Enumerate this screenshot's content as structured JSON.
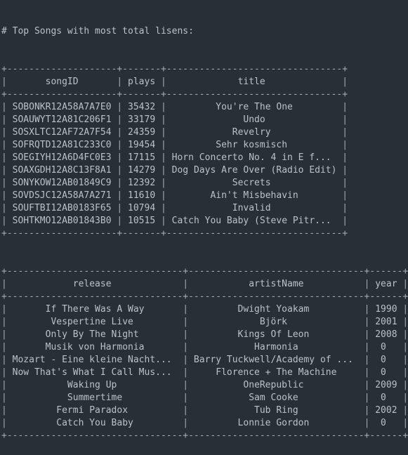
{
  "colors": {
    "background": "#263035",
    "text": "#b8c3c8",
    "border": "#9fadb3"
  },
  "heading": "# Top Songs with most total lisens:",
  "table1": {
    "columns": [
      {
        "header": "songID",
        "width": 20,
        "align": "left"
      },
      {
        "header": "plays",
        "width": 7,
        "align": "left"
      },
      {
        "header": "title",
        "width": 32,
        "align": "center"
      }
    ],
    "rows": [
      [
        "SOBONKR12A58A7A7E0",
        "35432",
        "You're The One"
      ],
      [
        "SOAUWYT12A81C206F1",
        "33179",
        "Undo"
      ],
      [
        "SOSXLTC12AF72A7F54",
        "24359",
        "Revelry"
      ],
      [
        "SOFRQTD12A81C233C0",
        "19454",
        "Sehr kosmisch"
      ],
      [
        "SOEGIYH12A6D4FC0E3",
        "17115",
        "Horn Concerto No. 4 in E f..."
      ],
      [
        "SOAXGDH12A8C13F8A1",
        "14279",
        "Dog Days Are Over (Radio Edit)"
      ],
      [
        "SONYKOW12AB01849C9",
        "12392",
        "Secrets"
      ],
      [
        "SOVDSJC12A58A7A271",
        "11610",
        "Ain't Misbehavin"
      ],
      [
        "SOUFTBI12AB0183F65",
        "10794",
        "Invalid"
      ],
      [
        "SOHTKMO12AB01843B0",
        "10515",
        "Catch You Baby (Steve Pitr..."
      ]
    ]
  },
  "table2": {
    "columns": [
      {
        "header": "release",
        "width": 32,
        "align": "center"
      },
      {
        "header": "artistName",
        "width": 32,
        "align": "center"
      },
      {
        "header": "year",
        "width": 6,
        "align": "center"
      }
    ],
    "rows": [
      [
        "If There Was A Way",
        "Dwight Yoakam",
        "1990"
      ],
      [
        "Vespertine Live",
        "Björk",
        "2001"
      ],
      [
        "Only By The Night",
        "Kings Of Leon",
        "2008"
      ],
      [
        "Musik von Harmonia",
        "Harmonia",
        "0"
      ],
      [
        "Mozart - Eine kleine Nacht...",
        "Barry Tuckwell/Academy of ...",
        "0"
      ],
      [
        "Now That's What I Call Mus...",
        "Florence + The Machine",
        "0"
      ],
      [
        "Waking Up",
        "OneRepublic",
        "2009"
      ],
      [
        "Summertime",
        "Sam Cooke",
        "0"
      ],
      [
        "Fermi Paradox",
        "Tub Ring",
        "2002"
      ],
      [
        "Catch You Baby",
        "Lonnie Gordon",
        "0"
      ]
    ]
  }
}
